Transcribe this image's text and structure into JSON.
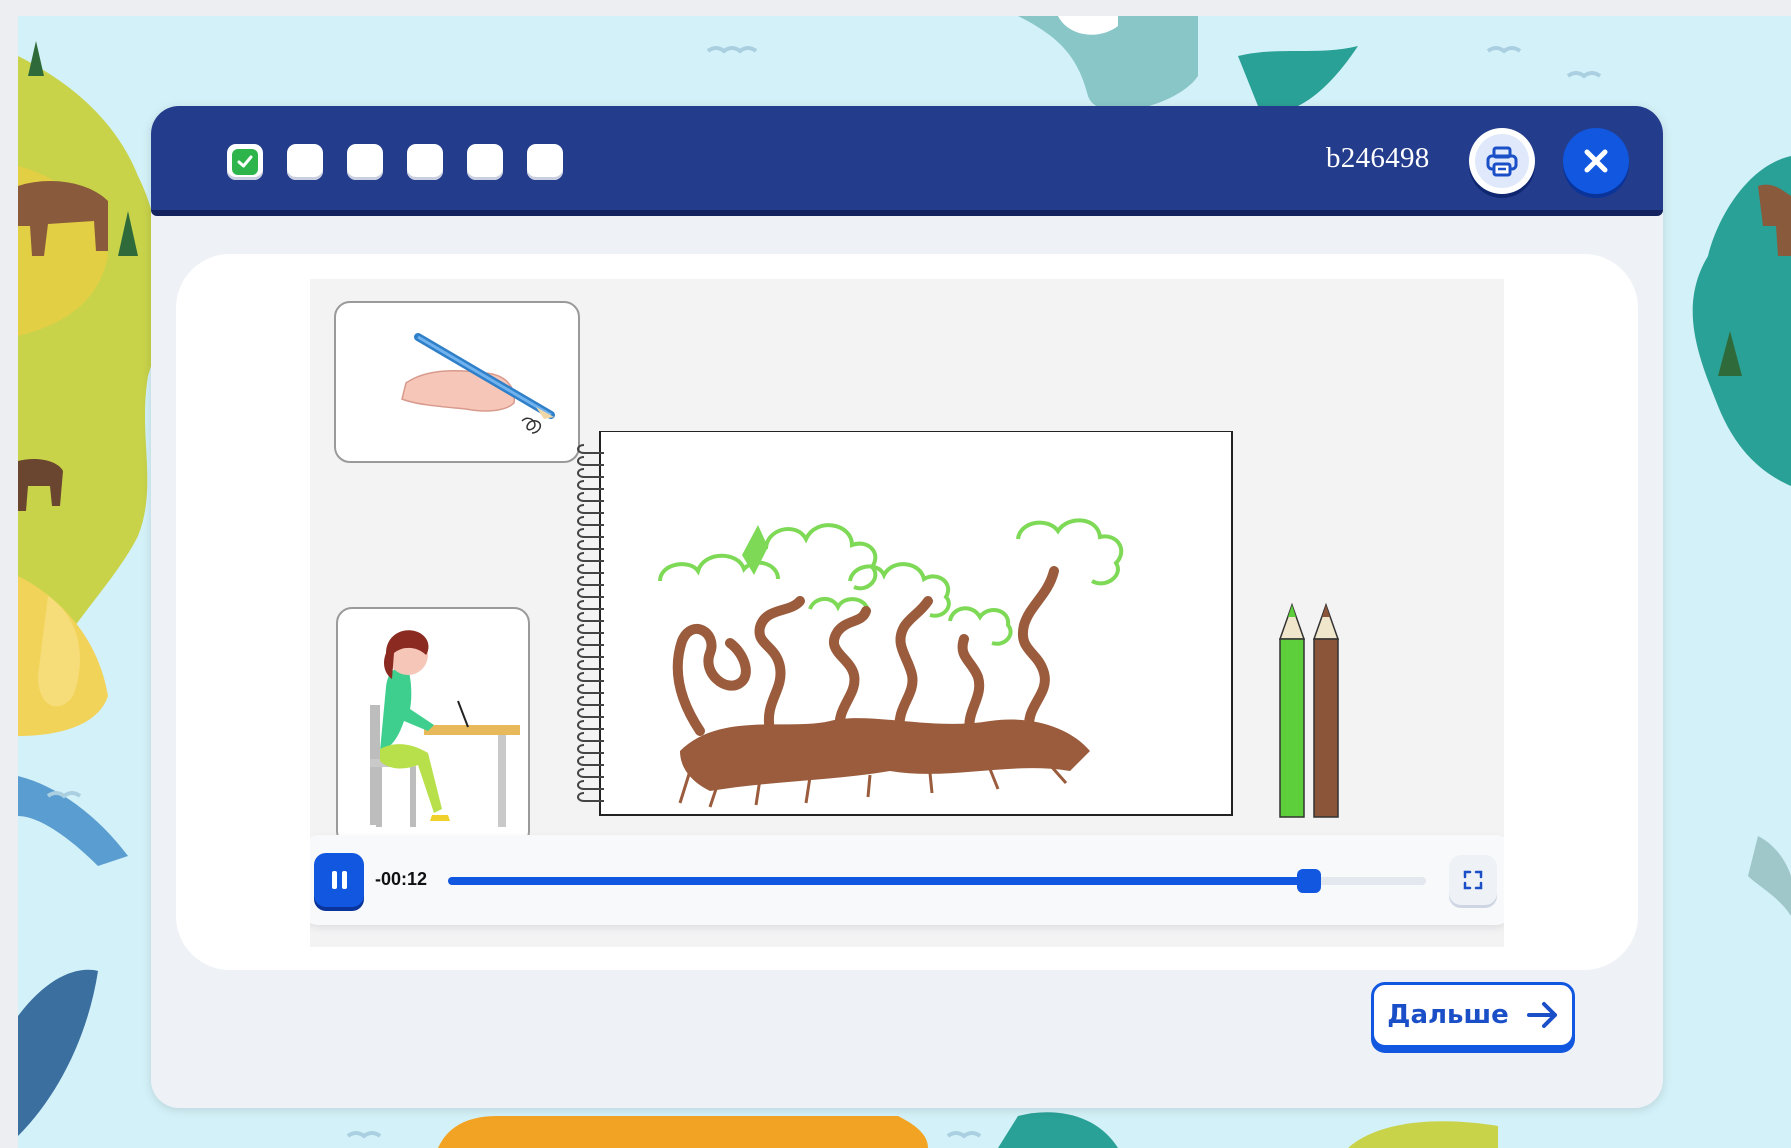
{
  "header": {
    "steps": [
      {
        "state": "done"
      },
      {
        "state": "pending"
      },
      {
        "state": "pending"
      },
      {
        "state": "pending"
      },
      {
        "state": "pending"
      },
      {
        "state": "pending"
      }
    ],
    "code": "b246498",
    "print_icon": "printer-icon",
    "close_icon": "close-icon"
  },
  "video": {
    "time_remaining": "-00:12",
    "progress": 0.88,
    "pause_icon": "pause-icon",
    "fullscreen_icon": "fullscreen-icon"
  },
  "footer": {
    "next_label": "Дальше",
    "next_icon": "arrow-right-icon"
  },
  "colors": {
    "header": "#233c8c",
    "accent": "#1157e0",
    "done": "#2db54c"
  }
}
